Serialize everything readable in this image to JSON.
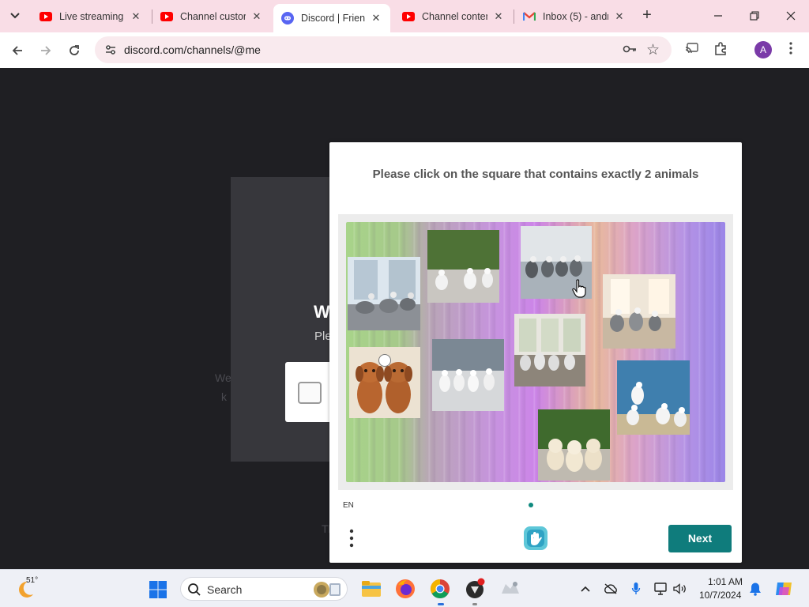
{
  "browser": {
    "tabs": [
      {
        "title": "Live streaming",
        "icon": "youtube-icon",
        "active": false
      },
      {
        "title": "Channel custor",
        "icon": "youtube-icon",
        "active": false
      },
      {
        "title": "Discord | Frienc",
        "icon": "discord-icon",
        "active": true
      },
      {
        "title": "Channel conten",
        "icon": "youtube-icon",
        "active": false
      },
      {
        "title": "Inbox (5) - andr",
        "icon": "gmail-icon",
        "active": false
      }
    ],
    "url": "discord.com/channels/@me",
    "profile_initial": "A"
  },
  "background_page": {
    "title": "W",
    "subtitle": "Ple",
    "faint_line_1": "We",
    "faint_line_2": "k",
    "faint_line_3": "Th"
  },
  "captcha": {
    "prompt": "Please click on the square that contains exactly 2 animals",
    "language": "EN",
    "next_label": "Next",
    "tiles": [
      {
        "subject": "seagulls"
      },
      {
        "subject": "seagulls"
      },
      {
        "subject": "seagulls"
      },
      {
        "subject": "seagulls"
      },
      {
        "subject": "two puppies"
      },
      {
        "subject": "seagulls"
      },
      {
        "subject": "seagulls"
      },
      {
        "subject": "seagulls"
      },
      {
        "subject": "puppies"
      }
    ]
  },
  "taskbar": {
    "weather_temp": "51°",
    "search_label": "Search",
    "time": "1:01 AM",
    "date": "10/7/2024"
  },
  "colors": {
    "tabstrip": "#f9dde6",
    "accent_button": "#0f7c7c",
    "youtube": "#ff0000",
    "discord": "#5865f2"
  }
}
